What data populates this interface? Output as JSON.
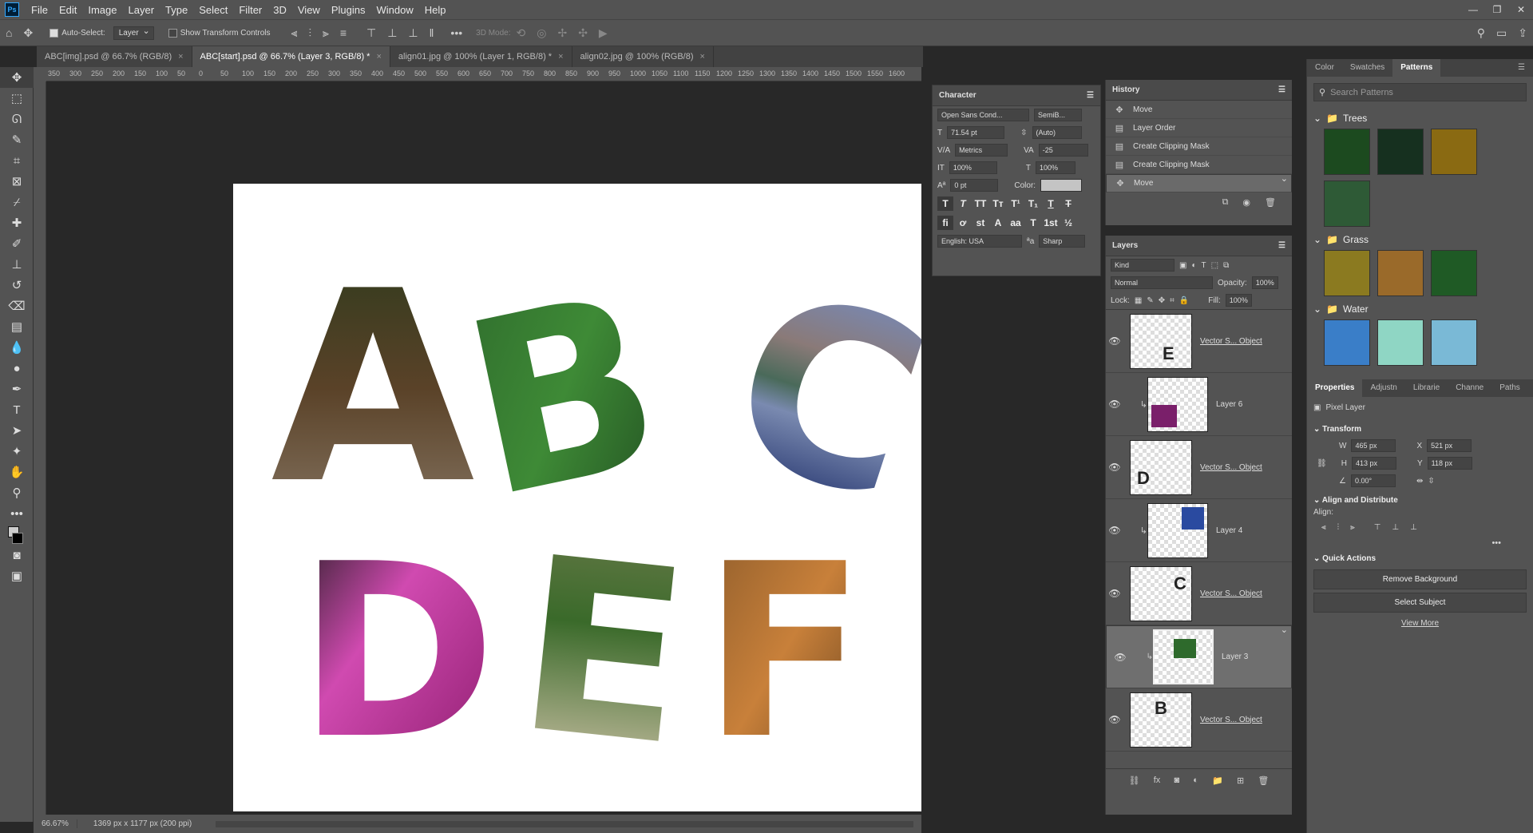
{
  "app": {
    "logo": "Ps"
  },
  "menu": [
    "File",
    "Edit",
    "Image",
    "Layer",
    "Type",
    "Select",
    "Filter",
    "3D",
    "View",
    "Plugins",
    "Window",
    "Help"
  ],
  "options": {
    "auto_select_label": "Auto-Select:",
    "auto_select_value": "Layer",
    "transform_label": "Show Transform Controls",
    "mode3d": "3D Mode:"
  },
  "tabs": [
    {
      "label": "ABC[img].psd @ 66.7% (RGB/8)"
    },
    {
      "label": "ABC[start].psd @ 66.7% (Layer 3, RGB/8) *"
    },
    {
      "label": "align01.jpg @ 100% (Layer 1, RGB/8) *"
    },
    {
      "label": "align02.jpg @ 100% (RGB/8)"
    }
  ],
  "ruler_ticks": [
    "350",
    "300",
    "250",
    "200",
    "150",
    "100",
    "50",
    "0",
    "50",
    "100",
    "150",
    "200",
    "250",
    "300",
    "350",
    "400",
    "450",
    "500",
    "550",
    "600",
    "650",
    "700",
    "750",
    "800",
    "850",
    "900",
    "950",
    "1000",
    "1050",
    "1100",
    "1150",
    "1200",
    "1250",
    "1300",
    "1350",
    "1400",
    "1450",
    "1500",
    "1550",
    "1600"
  ],
  "status": {
    "zoom": "66.67%",
    "doc_info": "1369 px x 1177 px (200 ppi)"
  },
  "character": {
    "title": "Character",
    "font": "Open Sans Cond...",
    "style": "SemiB...",
    "size": "71.54 pt",
    "leading": "(Auto)",
    "kerning": "Metrics",
    "tracking": "-25",
    "vscale": "100%",
    "hscale": "100%",
    "baseline": "0 pt",
    "color_label": "Color:",
    "language": "English: USA",
    "antialias": "Sharp"
  },
  "history": {
    "title": "History",
    "items": [
      "Move",
      "Layer Order",
      "Create Clipping Mask",
      "Create Clipping Mask",
      "Move"
    ]
  },
  "layers": {
    "title": "Layers",
    "kind": "Kind",
    "blend": "Normal",
    "opacity_label": "Opacity:",
    "opacity": "100%",
    "lock_label": "Lock:",
    "fill_label": "Fill:",
    "fill": "100%",
    "items": [
      {
        "name": "Vector S... Object",
        "letter": "E"
      },
      {
        "name": "Layer 6",
        "letter": ""
      },
      {
        "name": "Vector S... Object",
        "letter": "D"
      },
      {
        "name": "Layer 4",
        "letter": ""
      },
      {
        "name": "Vector S... Object",
        "letter": "C"
      },
      {
        "name": "Layer 3",
        "letter": ""
      },
      {
        "name": "Vector S... Object",
        "letter": "B"
      }
    ]
  },
  "patterns": {
    "tabs": [
      "Color",
      "Swatches",
      "Patterns"
    ],
    "search_placeholder": "Search Patterns",
    "groups": [
      {
        "name": "Trees",
        "colors": [
          "#1c4a1f",
          "#16301f",
          "#8a6a12",
          "#2e5a36"
        ]
      },
      {
        "name": "Grass",
        "colors": [
          "#8b7a20",
          "#9a6a2a",
          "#1f5a25"
        ]
      },
      {
        "name": "Water",
        "colors": [
          "#3a7ec8",
          "#8fd6c4",
          "#7ab9d6"
        ]
      }
    ]
  },
  "properties": {
    "tabs": [
      "Properties",
      "Adjustn",
      "Librarie",
      "Channe",
      "Paths"
    ],
    "layer_type": "Pixel Layer",
    "transform": "Transform",
    "w_label": "W",
    "w": "465 px",
    "h_label": "H",
    "h": "413 px",
    "x_label": "X",
    "x": "521 px",
    "y_label": "Y",
    "y": "118 px",
    "angle": "0.00°",
    "align_distribute": "Align and Distribute",
    "align_label": "Align:",
    "quick_actions": "Quick Actions",
    "remove_bg": "Remove Background",
    "select_subject": "Select Subject",
    "view_more": "View More"
  },
  "canvas_letters": {
    "a": "A",
    "b": "B",
    "c": "C",
    "d": "D",
    "e": "E",
    "f": "F"
  },
  "colors": {
    "accent": "#31a8ff",
    "panel": "#535353",
    "canvas_bg": "#282828"
  }
}
